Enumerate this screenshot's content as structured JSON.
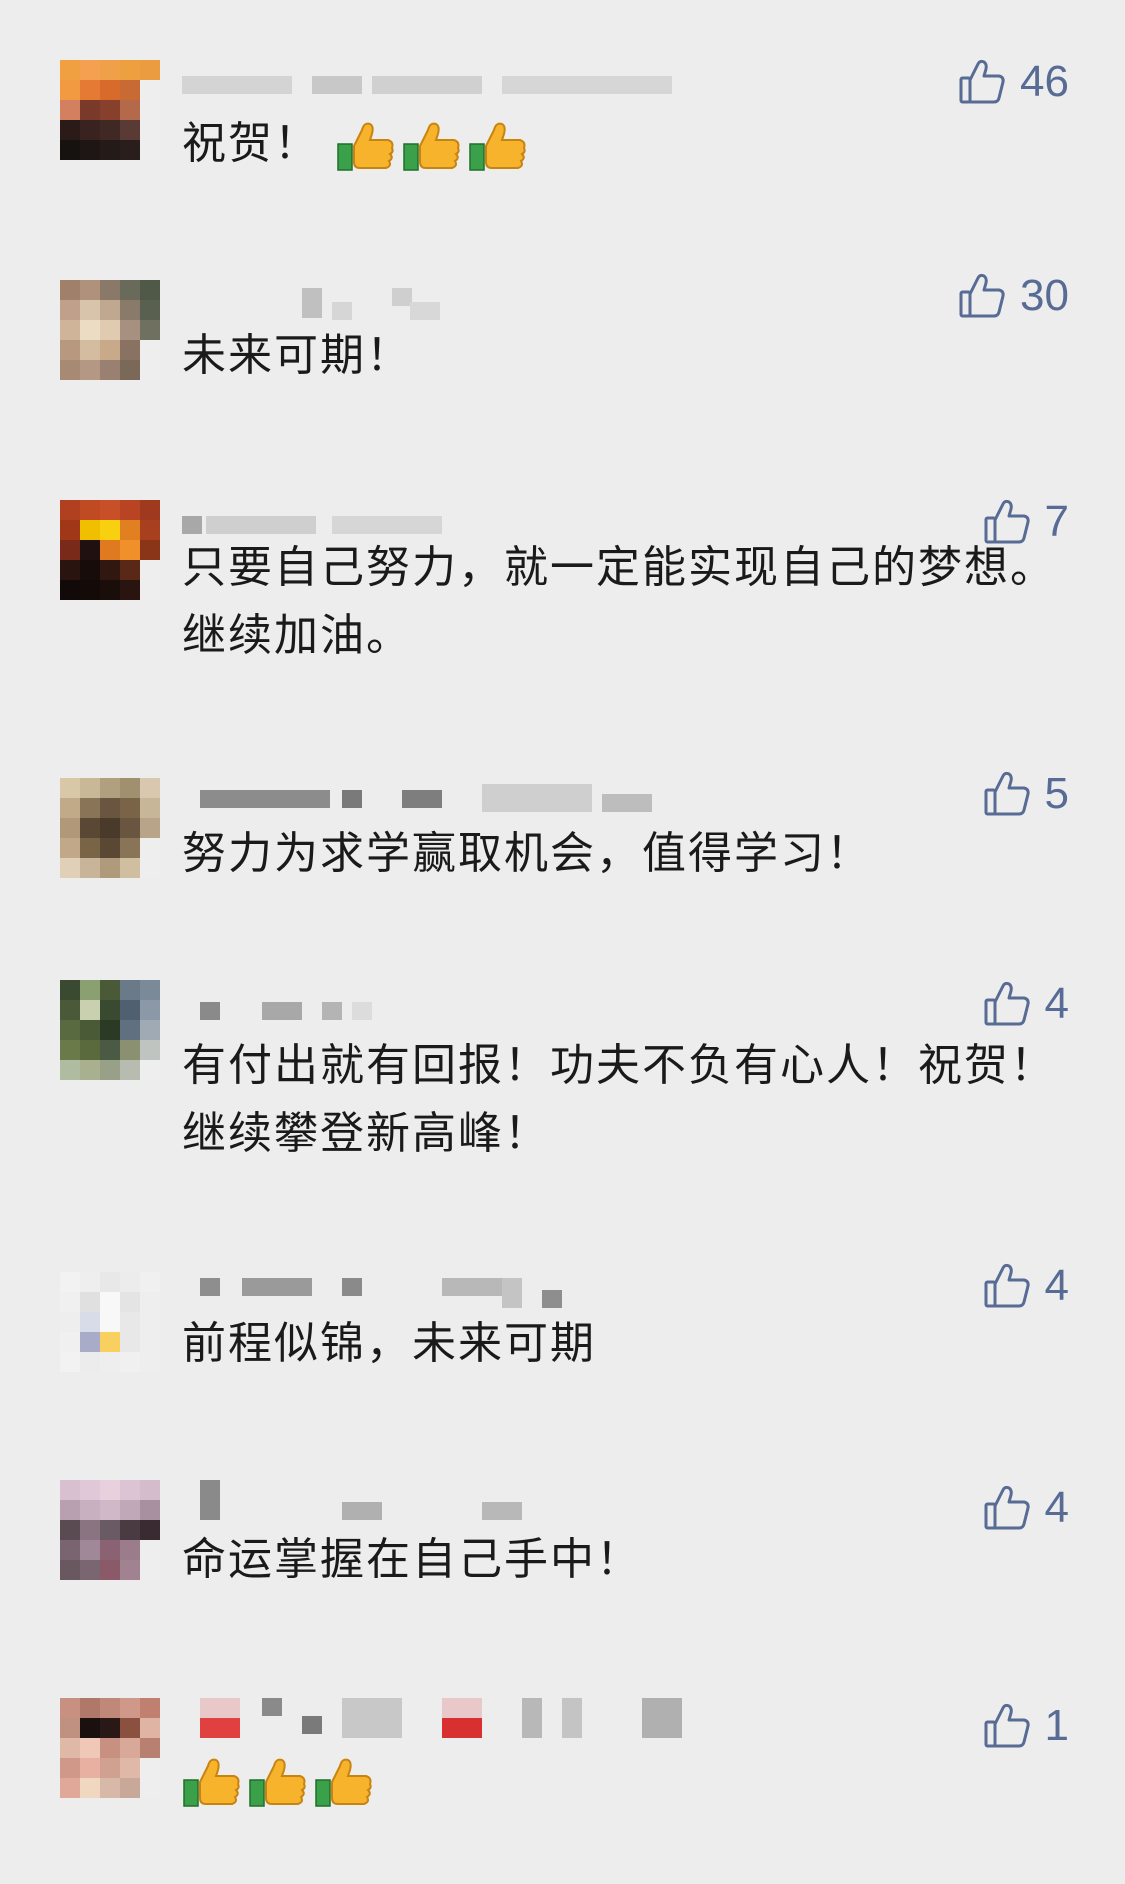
{
  "comments": [
    {
      "name": "",
      "text": "祝贺！",
      "emoji_count": 3,
      "likes": "46"
    },
    {
      "name": "",
      "text": "未来可期！",
      "emoji_count": 0,
      "likes": "30"
    },
    {
      "name": "",
      "text": "只要自己努力，就一定能实现自己的梦想。继续加油。",
      "emoji_count": 0,
      "likes": "7"
    },
    {
      "name": "",
      "text": "努力为求学赢取机会，值得学习！",
      "emoji_count": 0,
      "likes": "5"
    },
    {
      "name": "",
      "text": "有付出就有回报！功夫不负有心人！祝贺！继续攀登新高峰！",
      "emoji_count": 0,
      "likes": "4"
    },
    {
      "name": "",
      "text": "前程似锦，未来可期",
      "emoji_count": 0,
      "likes": "4"
    },
    {
      "name": "",
      "text": "命运掌握在自己手中！",
      "emoji_count": 0,
      "likes": "4"
    },
    {
      "name": "",
      "text": "",
      "emoji_count": 3,
      "likes": "1"
    }
  ],
  "icons": {
    "like": "thumbs-up-outline-icon",
    "emoji": "thumbs-up-emoji-icon"
  },
  "colors": {
    "background": "#ededed",
    "like": "#576b95",
    "text": "#1a1a1a"
  }
}
